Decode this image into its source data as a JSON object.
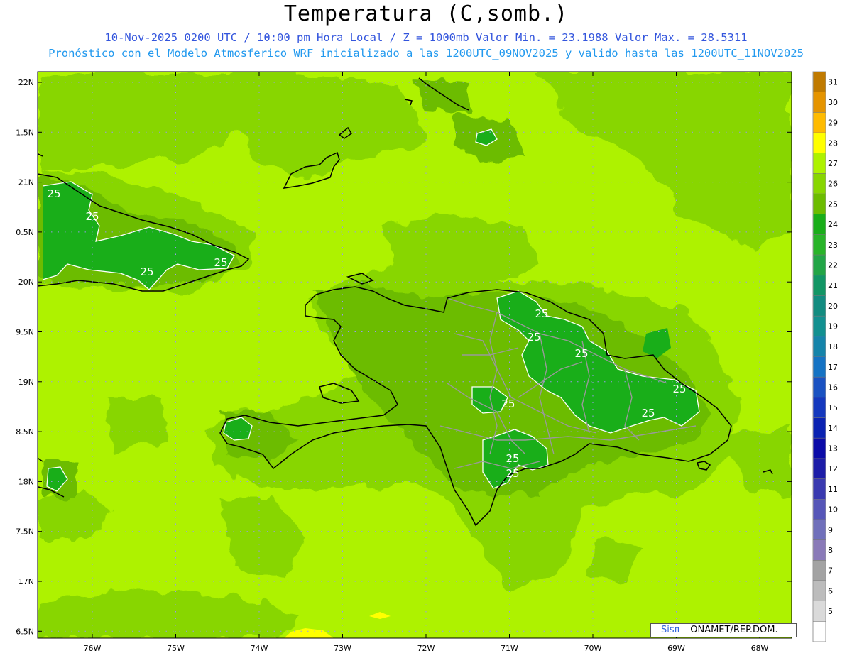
{
  "header": {
    "title": "Temperatura (C,somb.)",
    "subtitle_line1": "10-Nov-2025 0200 UTC / 10:00 pm Hora Local / Z = 1000mb  Valor Min. = 23.1988  Valor Max. = 28.5311",
    "subtitle_line2": "Pronóstico con el Modelo Atmosferico WRF inicializado a las 1200UTC_09NOV2025 y valido hasta las  1200UTC_11NOV2025"
  },
  "map": {
    "lat_labels": [
      "22N",
      "1.5N",
      "21N",
      "0.5N",
      "20N",
      "9.5N",
      "19N",
      "8.5N",
      "18N",
      "7.5N",
      "17N",
      "6.5N"
    ],
    "lon_labels": [
      "76W",
      "75W",
      "74W",
      "73W",
      "72W",
      "71W",
      "70W",
      "69W",
      "68W"
    ],
    "contour_labels": [
      "25",
      "25",
      "25",
      "25",
      "25",
      "25",
      "25",
      "25",
      "25",
      "25",
      "25",
      "25"
    ],
    "colors": {
      "temp_27": "#aef200",
      "temp_26": "#88d600",
      "temp_25": "#6cbc00",
      "temp_24": "#19ae19",
      "temp_28": "#ffff00",
      "coastline": "#000000",
      "provinces": "#999999",
      "grid_dots": "#9999ee"
    }
  },
  "colorbar": {
    "labels": [
      "31",
      "30",
      "29",
      "28",
      "27",
      "26",
      "25",
      "24",
      "23",
      "22",
      "21",
      "20",
      "19",
      "18",
      "17",
      "16",
      "15",
      "14",
      "13",
      "12",
      "11",
      "10",
      "9",
      "8",
      "7",
      "6",
      "5"
    ],
    "colors": [
      "#c07a00",
      "#e59400",
      "#ffbb00",
      "#ffff00",
      "#aef200",
      "#88d600",
      "#6cbc00",
      "#19ae19",
      "#28b428",
      "#22a546",
      "#129665",
      "#128c80",
      "#129090",
      "#1584aa",
      "#1573c4",
      "#1a52c2",
      "#1438be",
      "#0a22b2",
      "#0b0ba8",
      "#1d1da8",
      "#3a3ab0",
      "#5656b8",
      "#7070bb",
      "#8a7ab8",
      "#a3a3a3",
      "#bcbcbc",
      "#dadada",
      "#ffffff"
    ]
  },
  "credit": {
    "sis": "Sisπ",
    "org": " – ONAMET/REP.DOM."
  }
}
